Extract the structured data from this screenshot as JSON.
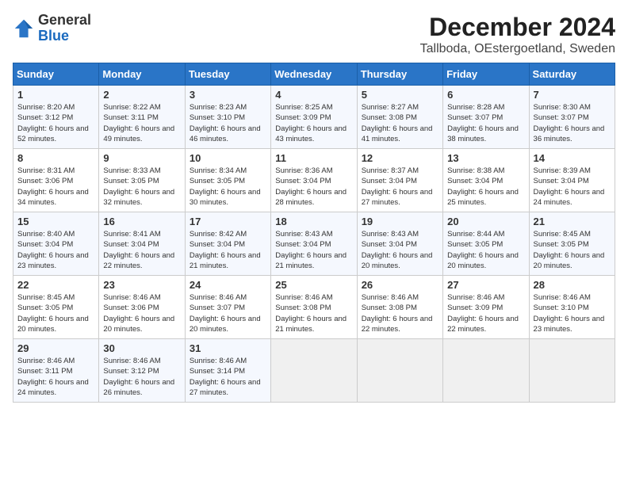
{
  "header": {
    "logo_general": "General",
    "logo_blue": "Blue",
    "month_title": "December 2024",
    "location": "Tallboda, OEstergoetland, Sweden"
  },
  "weekdays": [
    "Sunday",
    "Monday",
    "Tuesday",
    "Wednesday",
    "Thursday",
    "Friday",
    "Saturday"
  ],
  "weeks": [
    [
      {
        "day": "1",
        "sunrise": "Sunrise: 8:20 AM",
        "sunset": "Sunset: 3:12 PM",
        "daylight": "Daylight: 6 hours and 52 minutes."
      },
      {
        "day": "2",
        "sunrise": "Sunrise: 8:22 AM",
        "sunset": "Sunset: 3:11 PM",
        "daylight": "Daylight: 6 hours and 49 minutes."
      },
      {
        "day": "3",
        "sunrise": "Sunrise: 8:23 AM",
        "sunset": "Sunset: 3:10 PM",
        "daylight": "Daylight: 6 hours and 46 minutes."
      },
      {
        "day": "4",
        "sunrise": "Sunrise: 8:25 AM",
        "sunset": "Sunset: 3:09 PM",
        "daylight": "Daylight: 6 hours and 43 minutes."
      },
      {
        "day": "5",
        "sunrise": "Sunrise: 8:27 AM",
        "sunset": "Sunset: 3:08 PM",
        "daylight": "Daylight: 6 hours and 41 minutes."
      },
      {
        "day": "6",
        "sunrise": "Sunrise: 8:28 AM",
        "sunset": "Sunset: 3:07 PM",
        "daylight": "Daylight: 6 hours and 38 minutes."
      },
      {
        "day": "7",
        "sunrise": "Sunrise: 8:30 AM",
        "sunset": "Sunset: 3:07 PM",
        "daylight": "Daylight: 6 hours and 36 minutes."
      }
    ],
    [
      {
        "day": "8",
        "sunrise": "Sunrise: 8:31 AM",
        "sunset": "Sunset: 3:06 PM",
        "daylight": "Daylight: 6 hours and 34 minutes."
      },
      {
        "day": "9",
        "sunrise": "Sunrise: 8:33 AM",
        "sunset": "Sunset: 3:05 PM",
        "daylight": "Daylight: 6 hours and 32 minutes."
      },
      {
        "day": "10",
        "sunrise": "Sunrise: 8:34 AM",
        "sunset": "Sunset: 3:05 PM",
        "daylight": "Daylight: 6 hours and 30 minutes."
      },
      {
        "day": "11",
        "sunrise": "Sunrise: 8:36 AM",
        "sunset": "Sunset: 3:04 PM",
        "daylight": "Daylight: 6 hours and 28 minutes."
      },
      {
        "day": "12",
        "sunrise": "Sunrise: 8:37 AM",
        "sunset": "Sunset: 3:04 PM",
        "daylight": "Daylight: 6 hours and 27 minutes."
      },
      {
        "day": "13",
        "sunrise": "Sunrise: 8:38 AM",
        "sunset": "Sunset: 3:04 PM",
        "daylight": "Daylight: 6 hours and 25 minutes."
      },
      {
        "day": "14",
        "sunrise": "Sunrise: 8:39 AM",
        "sunset": "Sunset: 3:04 PM",
        "daylight": "Daylight: 6 hours and 24 minutes."
      }
    ],
    [
      {
        "day": "15",
        "sunrise": "Sunrise: 8:40 AM",
        "sunset": "Sunset: 3:04 PM",
        "daylight": "Daylight: 6 hours and 23 minutes."
      },
      {
        "day": "16",
        "sunrise": "Sunrise: 8:41 AM",
        "sunset": "Sunset: 3:04 PM",
        "daylight": "Daylight: 6 hours and 22 minutes."
      },
      {
        "day": "17",
        "sunrise": "Sunrise: 8:42 AM",
        "sunset": "Sunset: 3:04 PM",
        "daylight": "Daylight: 6 hours and 21 minutes."
      },
      {
        "day": "18",
        "sunrise": "Sunrise: 8:43 AM",
        "sunset": "Sunset: 3:04 PM",
        "daylight": "Daylight: 6 hours and 21 minutes."
      },
      {
        "day": "19",
        "sunrise": "Sunrise: 8:43 AM",
        "sunset": "Sunset: 3:04 PM",
        "daylight": "Daylight: 6 hours and 20 minutes."
      },
      {
        "day": "20",
        "sunrise": "Sunrise: 8:44 AM",
        "sunset": "Sunset: 3:05 PM",
        "daylight": "Daylight: 6 hours and 20 minutes."
      },
      {
        "day": "21",
        "sunrise": "Sunrise: 8:45 AM",
        "sunset": "Sunset: 3:05 PM",
        "daylight": "Daylight: 6 hours and 20 minutes."
      }
    ],
    [
      {
        "day": "22",
        "sunrise": "Sunrise: 8:45 AM",
        "sunset": "Sunset: 3:05 PM",
        "daylight": "Daylight: 6 hours and 20 minutes."
      },
      {
        "day": "23",
        "sunrise": "Sunrise: 8:46 AM",
        "sunset": "Sunset: 3:06 PM",
        "daylight": "Daylight: 6 hours and 20 minutes."
      },
      {
        "day": "24",
        "sunrise": "Sunrise: 8:46 AM",
        "sunset": "Sunset: 3:07 PM",
        "daylight": "Daylight: 6 hours and 20 minutes."
      },
      {
        "day": "25",
        "sunrise": "Sunrise: 8:46 AM",
        "sunset": "Sunset: 3:08 PM",
        "daylight": "Daylight: 6 hours and 21 minutes."
      },
      {
        "day": "26",
        "sunrise": "Sunrise: 8:46 AM",
        "sunset": "Sunset: 3:08 PM",
        "daylight": "Daylight: 6 hours and 22 minutes."
      },
      {
        "day": "27",
        "sunrise": "Sunrise: 8:46 AM",
        "sunset": "Sunset: 3:09 PM",
        "daylight": "Daylight: 6 hours and 22 minutes."
      },
      {
        "day": "28",
        "sunrise": "Sunrise: 8:46 AM",
        "sunset": "Sunset: 3:10 PM",
        "daylight": "Daylight: 6 hours and 23 minutes."
      }
    ],
    [
      {
        "day": "29",
        "sunrise": "Sunrise: 8:46 AM",
        "sunset": "Sunset: 3:11 PM",
        "daylight": "Daylight: 6 hours and 24 minutes."
      },
      {
        "day": "30",
        "sunrise": "Sunrise: 8:46 AM",
        "sunset": "Sunset: 3:12 PM",
        "daylight": "Daylight: 6 hours and 26 minutes."
      },
      {
        "day": "31",
        "sunrise": "Sunrise: 8:46 AM",
        "sunset": "Sunset: 3:14 PM",
        "daylight": "Daylight: 6 hours and 27 minutes."
      },
      null,
      null,
      null,
      null
    ]
  ]
}
